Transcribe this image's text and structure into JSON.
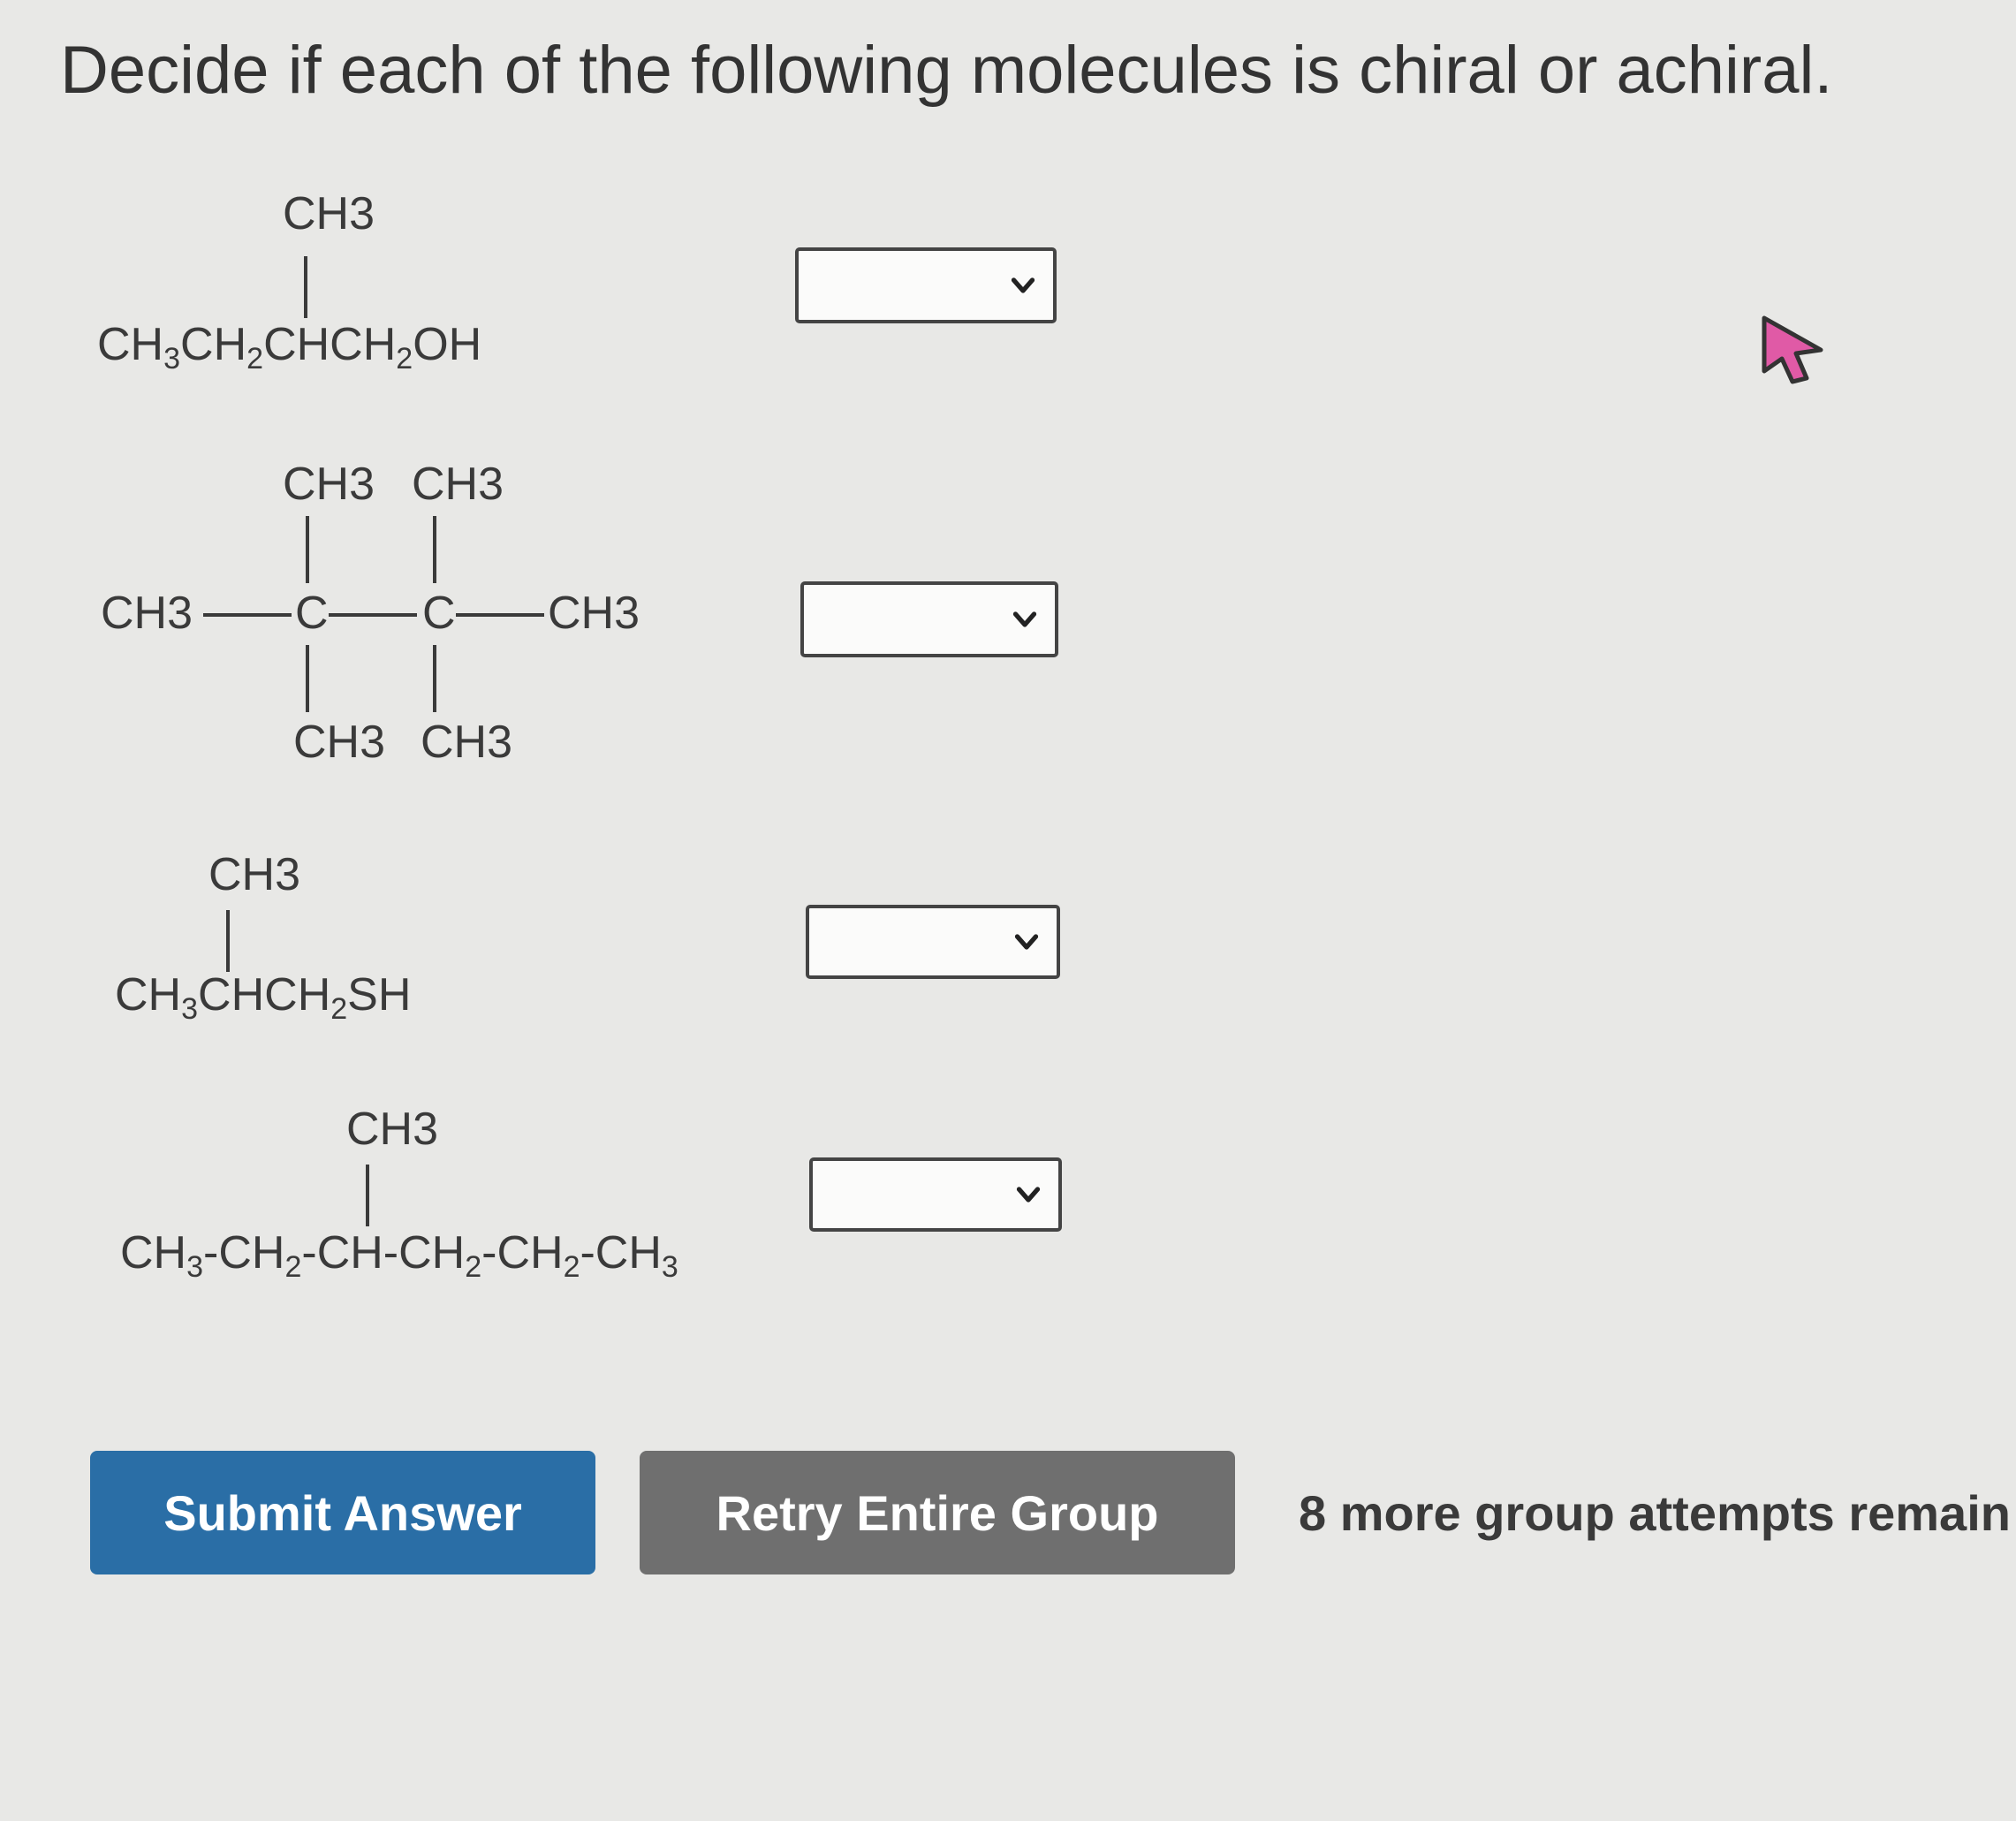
{
  "question": "Decide if each of the following molecules is chiral or achiral.",
  "molecules": [
    {
      "top_group": "CH3",
      "main_chain": [
        "CH",
        "3",
        "CH",
        "2",
        "CHCH",
        "2",
        "OH"
      ]
    },
    {
      "top_left": "CH3",
      "top_right": "CH3",
      "left_end": "CH3",
      "c1": "C",
      "c2": "C",
      "right_end": "CH3",
      "bottom_left": "CH3",
      "bottom_right": "CH3"
    },
    {
      "top_group": "CH3",
      "main_chain": [
        "CH",
        "3",
        "CHCH",
        "2",
        "SH"
      ]
    },
    {
      "top_group": "CH3",
      "main_chain": [
        "CH",
        "3",
        "-CH",
        "2",
        "-CH-CH",
        "2",
        "-CH",
        "2",
        "-CH",
        "3"
      ]
    }
  ],
  "dropdowns": [
    {
      "selected": ""
    },
    {
      "selected": ""
    },
    {
      "selected": ""
    },
    {
      "selected": ""
    }
  ],
  "buttons": {
    "submit": "Submit Answer",
    "retry": "Retry Entire Group"
  },
  "attempts_text": "8 more group attempts remain"
}
